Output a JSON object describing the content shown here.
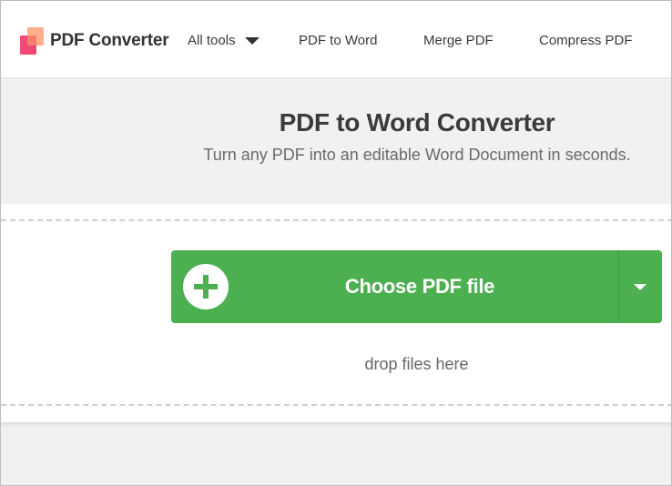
{
  "header": {
    "brand": "PDF Converter",
    "nav": {
      "all_tools": "All tools",
      "pdf_to_word": "PDF to Word",
      "merge_pdf": "Merge PDF",
      "compress_pdf": "Compress PDF"
    }
  },
  "hero": {
    "title": "PDF to Word Converter",
    "subtitle": "Turn any PDF into an editable Word Document in seconds."
  },
  "upload": {
    "choose_label": "Choose PDF file",
    "drop_text": "drop files here"
  },
  "colors": {
    "accent_green": "#4caf50",
    "logo_pink": "#ec407a",
    "logo_orange": "#ffab7d"
  },
  "icons": {
    "logo": "pdf-converter-logo",
    "all_tools_caret": "caret-down-icon",
    "plus": "plus-icon",
    "dropdown_caret": "caret-down-icon"
  }
}
